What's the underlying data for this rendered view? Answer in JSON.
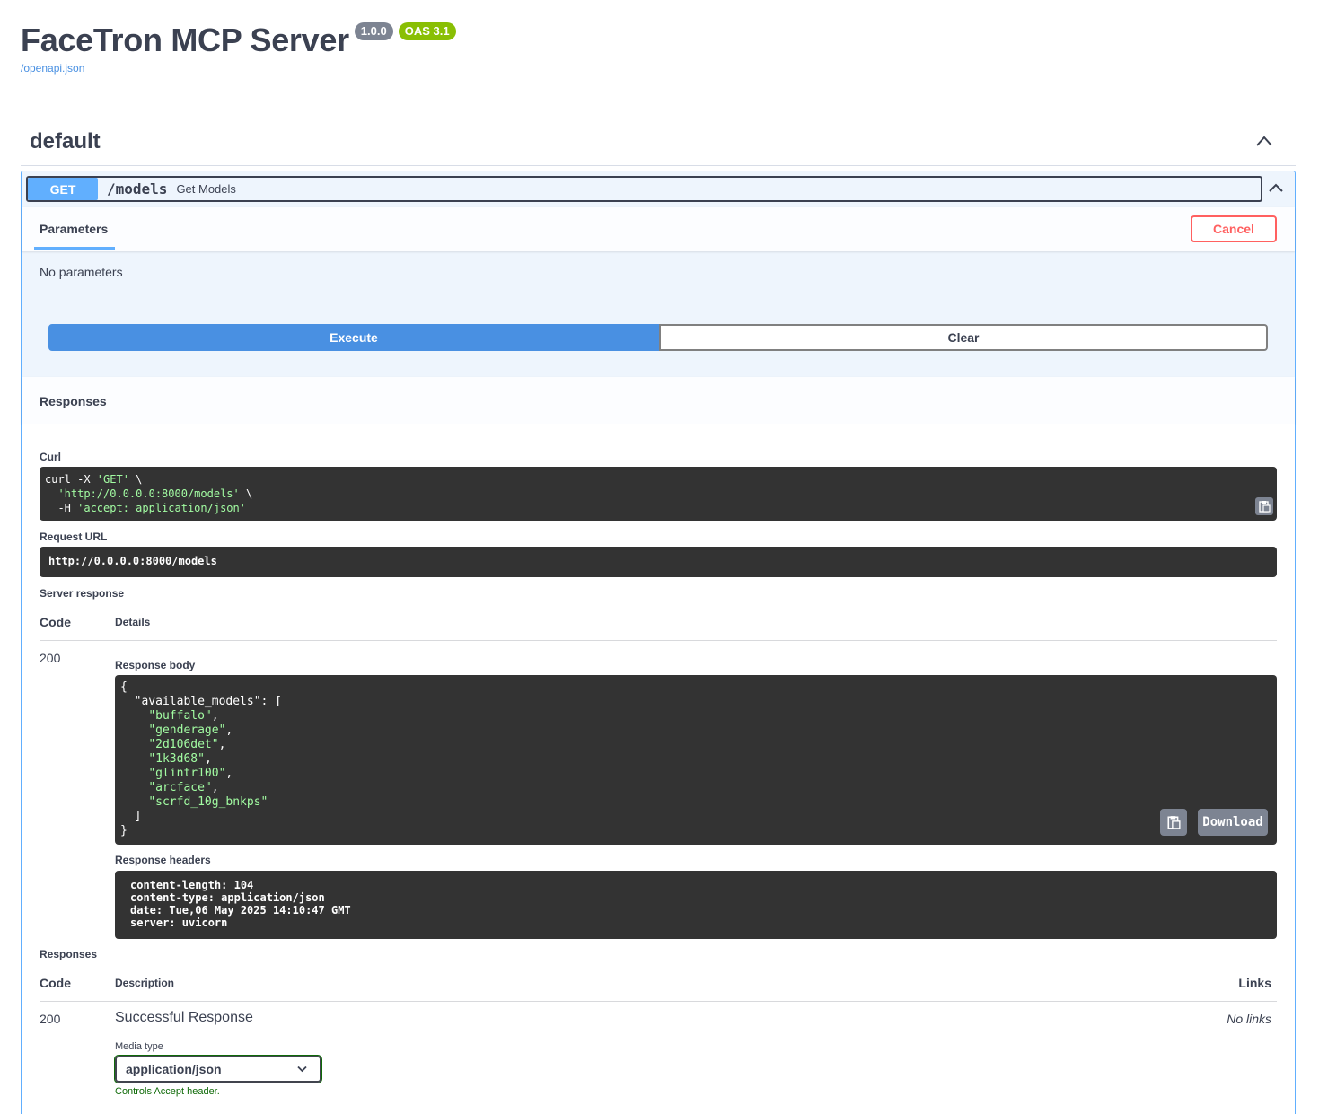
{
  "header": {
    "title": "FaceTron MCP Server",
    "version_badge": "1.0.0",
    "oas_badge": "OAS 3.1",
    "spec_link": "/openapi.json"
  },
  "tag": {
    "name": "default"
  },
  "operation": {
    "method": "GET",
    "path": "/models",
    "summary": "Get Models",
    "parameters_tab": "Parameters",
    "cancel_label": "Cancel",
    "no_parameters": "No parameters",
    "execute_label": "Execute",
    "clear_label": "Clear",
    "responses_title": "Responses"
  },
  "live": {
    "curl_label": "Curl",
    "curl_lines": [
      "curl -X ",
      "'GET'",
      " \\",
      "  ",
      "'http://0.0.0.0:8000/models'",
      " \\",
      "  -H ",
      "'accept: application/json'"
    ],
    "request_url_label": "Request URL",
    "request_url": "http://0.0.0.0:8000/models",
    "server_response_label": "Server response",
    "code_header": "Code",
    "details_header": "Details",
    "status_code": "200",
    "response_body_label": "Response body",
    "response_body": {
      "open": "{",
      "key": "  \"available_models\": [",
      "items": [
        "\"buffalo\"",
        "\"genderage\"",
        "\"2d106det\"",
        "\"1k3d68\"",
        "\"glintr100\"",
        "\"arcface\"",
        "\"scrfd_10g_bnkps\""
      ],
      "close_arr": "  ]",
      "close": "}"
    },
    "download_label": "Download",
    "response_headers_label": "Response headers",
    "response_headers": [
      "content-length: 104",
      "content-type: application/json",
      "date: Tue,06 May 2025 14:10:47 GMT",
      "server: uvicorn"
    ]
  },
  "documented": {
    "responses_label": "Responses",
    "code_header": "Code",
    "description_header": "Description",
    "links_header": "Links",
    "code": "200",
    "description": "Successful Response",
    "links": "No links",
    "media_type_label": "Media type",
    "media_type_value": "application/json",
    "media_type_hint": "Controls Accept header."
  },
  "colors": {
    "get": "#61affe",
    "execute": "#4990e2",
    "cancel": "#ff6060",
    "oas_badge": "#89bf04",
    "string": "#a2fca2"
  }
}
